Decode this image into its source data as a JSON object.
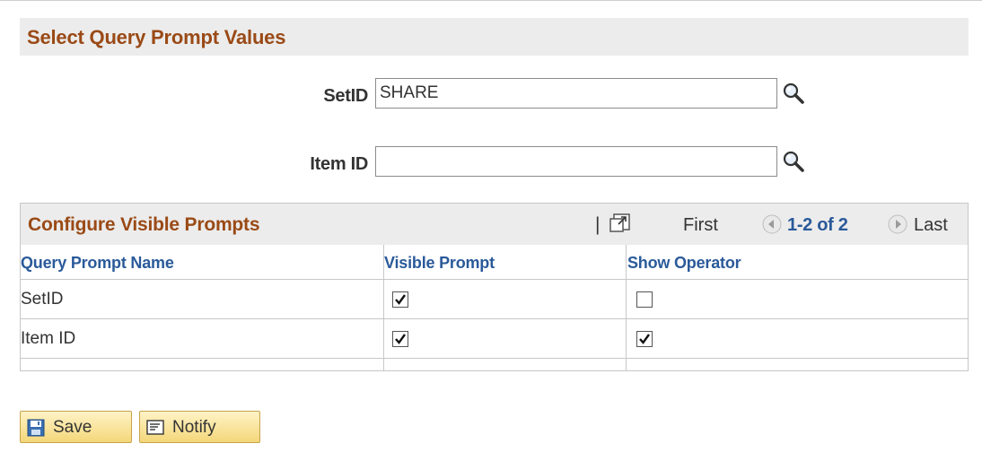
{
  "section": {
    "title": "Select Query Prompt Values"
  },
  "fields": {
    "setid": {
      "label": "SetID",
      "value": "SHARE"
    },
    "itemid": {
      "label": "Item ID",
      "value": ""
    }
  },
  "grid": {
    "title": "Configure Visible Prompts",
    "separator": "|",
    "nav": {
      "first": "First",
      "count": "1-2 of 2",
      "last": "Last"
    },
    "columns": [
      "Query Prompt Name",
      "Visible Prompt",
      "Show Operator"
    ],
    "rows": [
      {
        "name": "SetID",
        "visible": true,
        "show_operator": false
      },
      {
        "name": "Item ID",
        "visible": true,
        "show_operator": true
      }
    ]
  },
  "buttons": {
    "save": "Save",
    "notify": "Notify"
  },
  "colors": {
    "header_text": "#9a4a16",
    "link_blue": "#2a5a9a",
    "header_bg": "#ececec"
  },
  "icons": [
    "lookup-icon",
    "zoom-grid-icon",
    "nav-previous-icon",
    "nav-next-icon",
    "save-icon",
    "notify-icon"
  ]
}
